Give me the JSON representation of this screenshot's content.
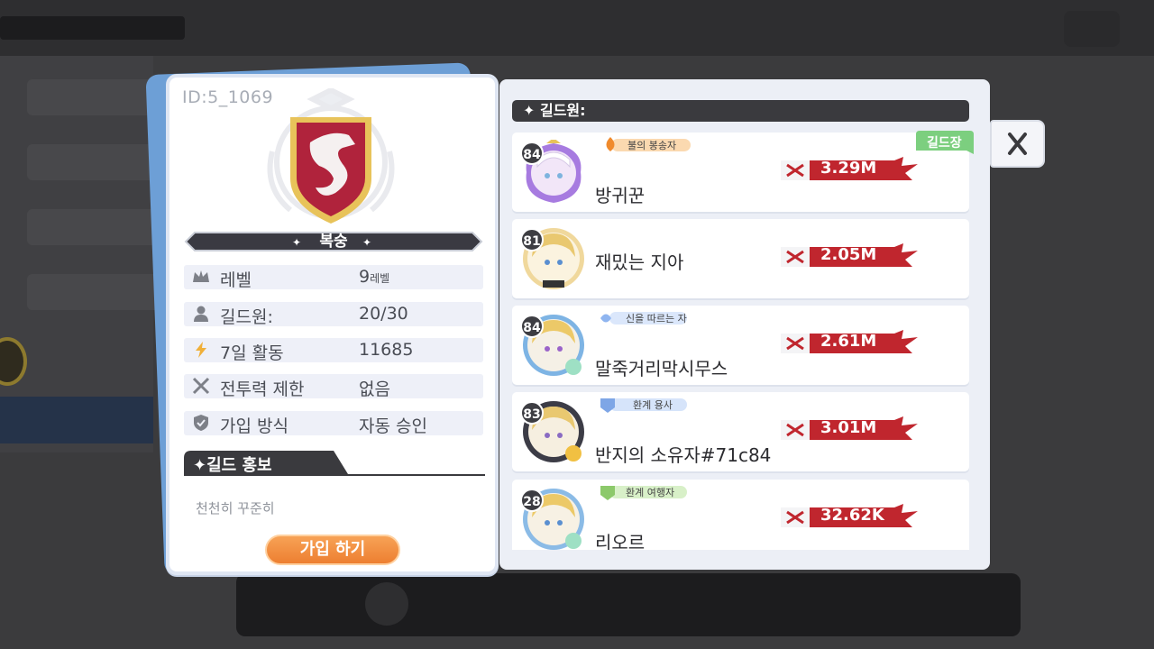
{
  "guild": {
    "id": "ID:5_1069",
    "name": "복숭",
    "info": [
      {
        "icon": "crown-icon",
        "label": "레벨",
        "value": "9",
        "unit": "레벨"
      },
      {
        "icon": "person-icon",
        "label": "길드원:",
        "value": "20/30",
        "unit": ""
      },
      {
        "icon": "lightning-icon",
        "label": "7일 활동",
        "value": "11685",
        "unit": ""
      },
      {
        "icon": "crossed-swords-icon",
        "label": "전투력 제한",
        "value": "없음",
        "unit": ""
      },
      {
        "icon": "shield-check-icon",
        "label": "가입 방식",
        "value": "자동 승인",
        "unit": ""
      }
    ],
    "promo_title": "✦길드 홍보",
    "promo_text": "천천히 꾸준히",
    "join_label": "가입 하기"
  },
  "members_header": "✦ 길드원:",
  "leader_tag": "길드장",
  "members": [
    {
      "level": "84",
      "title": "불의 봉송자",
      "name": "방귀꾼",
      "power": "3.29M",
      "title_color": "#f6a24a"
    },
    {
      "level": "81",
      "title": "",
      "name": "재밌는 지아",
      "power": "2.05M",
      "title_color": ""
    },
    {
      "level": "84",
      "title": "신을 따르는 자",
      "name": "말죽거리막시무스",
      "power": "2.61M",
      "title_color": "#8fb5f0"
    },
    {
      "level": "83",
      "title": "환계 용사",
      "name": "반지의 소유자#71c84",
      "power": "3.01M",
      "title_color": "#7ea6e6"
    },
    {
      "level": "28",
      "title": "환계 여행자",
      "name": "리오르",
      "power": "32.62K",
      "title_color": "#8cc96a"
    }
  ],
  "colors": {
    "accent_orange": "#ed7f31",
    "power_red": "#c0262e",
    "leader_green": "#7ccf7f",
    "crest_red": "#b0233c",
    "crest_gold": "#e8c35a"
  }
}
